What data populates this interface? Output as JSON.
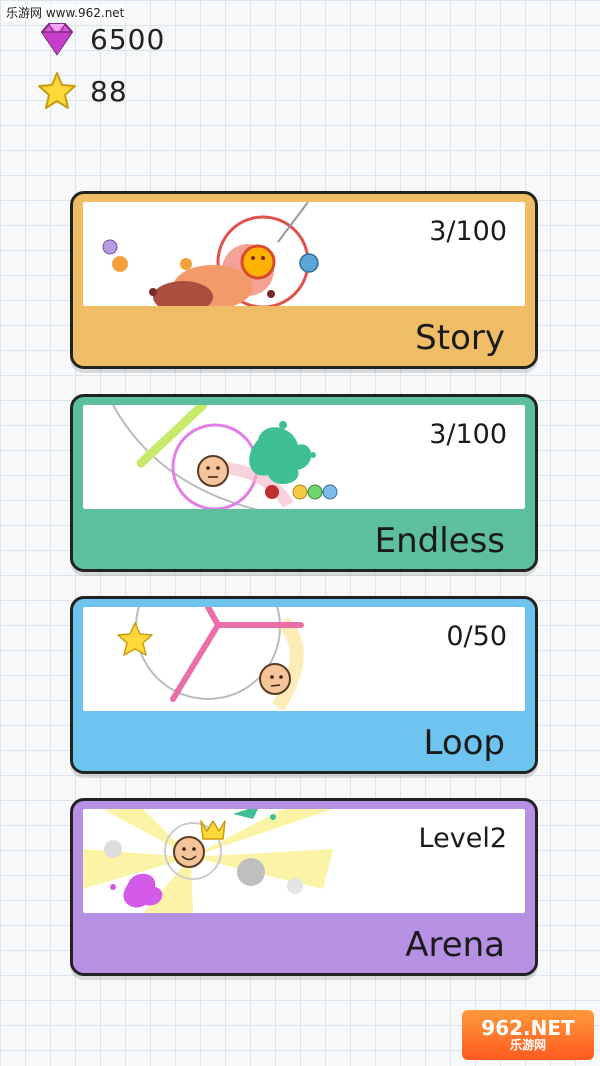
{
  "watermark_top": "乐游网 www.962.net",
  "resources": {
    "gems": "6500",
    "stars": "88"
  },
  "modes": [
    {
      "name": "Story",
      "progress": "3/100",
      "color": "#f0bd67",
      "inner": "#ffffff"
    },
    {
      "name": "Endless",
      "progress": "3/100",
      "color": "#5dbf9e",
      "inner": "#ffffff"
    },
    {
      "name": "Loop",
      "progress": "0/50",
      "color": "#6fc3ef",
      "inner": "#ffffff"
    },
    {
      "name": "Arena",
      "progress": "Level2",
      "color": "#b590e3",
      "inner": "#ffffff"
    }
  ],
  "watermark_bottom": {
    "line1": "962.NET",
    "line2": "乐游网"
  }
}
